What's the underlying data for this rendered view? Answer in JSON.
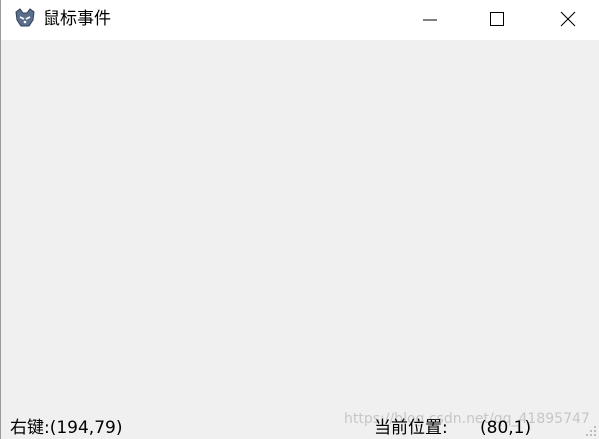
{
  "window": {
    "title": "鼠标事件",
    "icon": "java-app-icon",
    "controls": {
      "minimize": "minimize-icon",
      "maximize": "maximize-icon",
      "close": "close-icon"
    }
  },
  "status": {
    "left_text": "右键:(194,79)",
    "position_label": "当前位置:",
    "position_value": "(80,1)"
  },
  "watermark": "https://blog.csdn.net/qq_41895747",
  "colors": {
    "titlebar": "#ffffff",
    "client": "#f0f0f0",
    "text": "#000000"
  }
}
